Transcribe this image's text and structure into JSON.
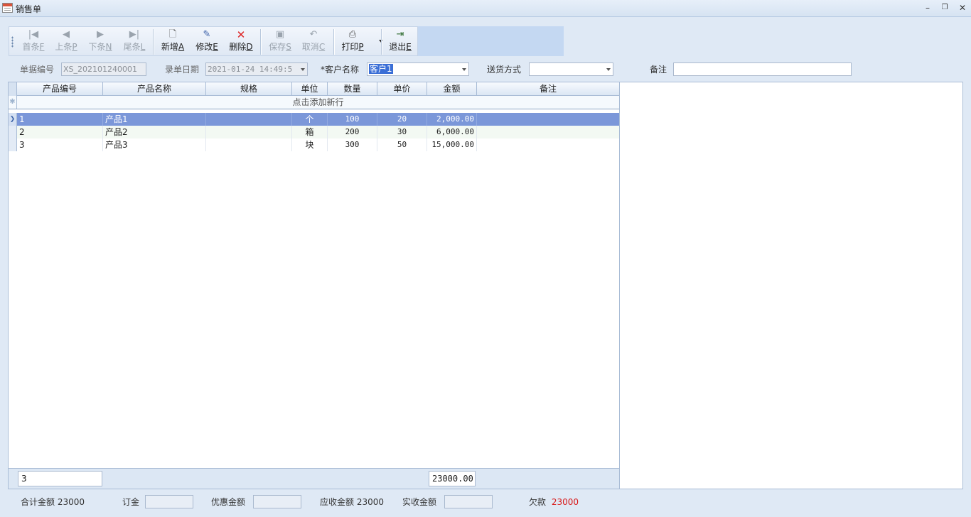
{
  "window": {
    "title": "销售单",
    "controls": {
      "minimize": "–",
      "restore": "❐",
      "close": "✕"
    }
  },
  "toolbar": {
    "buttons": [
      {
        "id": "first",
        "label": "首条",
        "key": "F",
        "icon": "first-icon",
        "glyph": "|◀",
        "enabled": false
      },
      {
        "id": "prev",
        "label": "上条",
        "key": "P",
        "icon": "prev-icon",
        "glyph": "◀",
        "enabled": false
      },
      {
        "id": "next",
        "label": "下条",
        "key": "N",
        "icon": "next-icon",
        "glyph": "▶",
        "enabled": false
      },
      {
        "id": "last",
        "label": "尾条",
        "key": "L",
        "icon": "last-icon",
        "glyph": "▶|",
        "enabled": false
      },
      {
        "id": "new",
        "label": "新增",
        "key": "A",
        "icon": "new-document-icon",
        "glyph": "🗋",
        "enabled": true
      },
      {
        "id": "edit",
        "label": "修改",
        "key": "E",
        "icon": "edit-icon",
        "glyph": "✎",
        "enabled": true
      },
      {
        "id": "delete",
        "label": "删除",
        "key": "D",
        "icon": "delete-icon",
        "glyph": "✕",
        "enabled": true
      },
      {
        "id": "save",
        "label": "保存",
        "key": "S",
        "icon": "save-icon",
        "glyph": "▣",
        "enabled": false
      },
      {
        "id": "cancel",
        "label": "取消",
        "key": "C",
        "icon": "undo-icon",
        "glyph": "↶",
        "enabled": false
      },
      {
        "id": "print",
        "label": "打印",
        "key": "P",
        "icon": "printer-icon",
        "glyph": "⎙",
        "enabled": true
      },
      {
        "id": "exit",
        "label": "退出",
        "key": "E",
        "icon": "exit-icon",
        "glyph": "⇥",
        "enabled": true
      }
    ]
  },
  "form": {
    "doc_no_label": "单据编号",
    "doc_no_value": "XS_202101240001",
    "date_label": "录单日期",
    "date_value": "2021-01-24 14:49:5",
    "customer_label": "*客户名称",
    "customer_value": "客户1",
    "delivery_label": "送货方式",
    "delivery_value": "",
    "remark_label": "备注",
    "remark_value": ""
  },
  "grid": {
    "columns": [
      "产品编号",
      "产品名称",
      "规格",
      "单位",
      "数量",
      "单价",
      "金额",
      "备注"
    ],
    "new_row_text": "点击添加新行",
    "rows": [
      {
        "code": "1",
        "name": "产品1",
        "spec": "",
        "unit": "个",
        "qty": "100",
        "price": "20",
        "amount": "2,000.00",
        "remark": ""
      },
      {
        "code": "2",
        "name": "产品2",
        "spec": "",
        "unit": "箱",
        "qty": "200",
        "price": "30",
        "amount": "6,000.00",
        "remark": ""
      },
      {
        "code": "3",
        "name": "产品3",
        "spec": "",
        "unit": "块",
        "qty": "300",
        "price": "50",
        "amount": "15,000.00",
        "remark": ""
      }
    ],
    "selected_row": 0,
    "footer": {
      "count": "3",
      "total_amount": "23000.00"
    }
  },
  "summary": {
    "total_label": "合计金额",
    "total_value": "23000",
    "deposit_label": "订金",
    "discount_label": "优惠金额",
    "receivable_label": "应收金额",
    "receivable_value": "23000",
    "received_label": "实收金额",
    "owed_label": "欠款",
    "owed_value": "23000"
  },
  "colors": {
    "selected_row": "#7b97d9",
    "owed_text": "#d81818",
    "toolbar_ext": "#c4d8f2"
  }
}
